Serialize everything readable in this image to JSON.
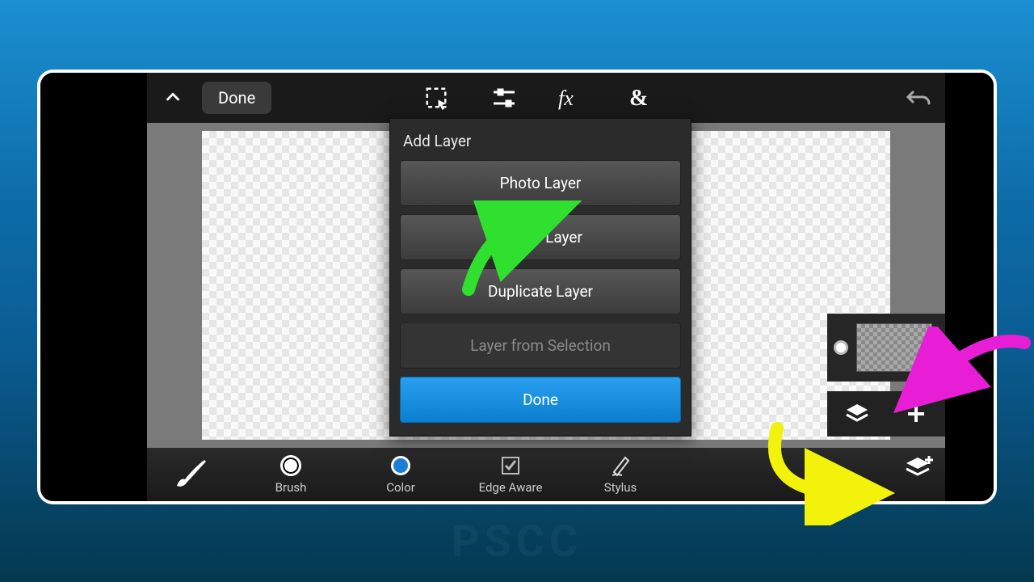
{
  "topbar": {
    "done_label": "Done"
  },
  "popup": {
    "title": "Add Layer",
    "photo_layer": "Photo Layer",
    "empty_layer": "Empty Layer",
    "duplicate_layer": "Duplicate Layer",
    "layer_from_selection": "Layer from Selection",
    "done": "Done"
  },
  "bottom": {
    "brush": "Brush",
    "color": "Color",
    "edge_aware": "Edge Aware",
    "stylus": "Stylus"
  },
  "colors": {
    "primary_blue": "#1b8fd1",
    "annotation_green": "#2fe02f",
    "annotation_pink": "#e81ed6",
    "annotation_yellow": "#f2f20a"
  },
  "watermark": "PSCC"
}
